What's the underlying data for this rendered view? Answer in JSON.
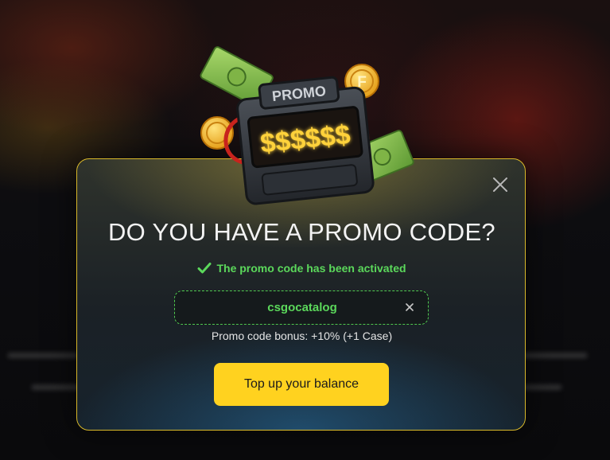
{
  "modal": {
    "title": "DO YOU HAVE A PROMO CODE?",
    "success_message": "The promo code has been activated",
    "promo_code_value": "csgocatalog",
    "bonus_text": "Promo code bonus: +10% (+1 Case)",
    "topup_button_label": "Top up your balance"
  },
  "illustration": {
    "sign_label": "PROMO",
    "display_text": "$$$$$$",
    "coin_letter": "F"
  },
  "icons": {
    "close": "close-icon",
    "check": "check-icon",
    "clear": "clear-icon"
  },
  "colors": {
    "accent_yellow": "#ffd21f",
    "success_green": "#5bd85b",
    "modal_border": "#d8b82a"
  }
}
